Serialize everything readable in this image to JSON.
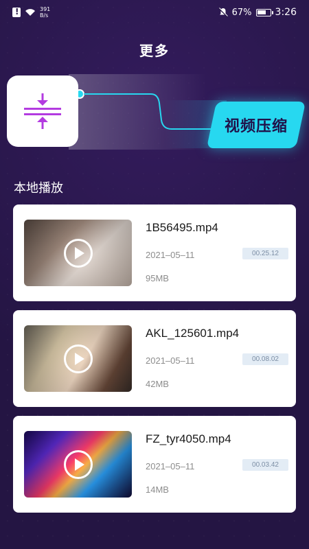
{
  "status_bar": {
    "speed_value": "391",
    "speed_unit": "B/s",
    "battery": "67%",
    "time": "3:26",
    "icons": [
      "alert-icon",
      "wifi-icon",
      "mute-bell-icon",
      "battery-icon"
    ]
  },
  "header": {
    "title": "更多"
  },
  "banner": {
    "button_label": "视频压缩",
    "icon": "compress-icon",
    "colors": {
      "accent": "#27d8f0",
      "icon_purple": "#b33be0"
    }
  },
  "section": {
    "title": "本地播放"
  },
  "videos": [
    {
      "name": "1B56495.mp4",
      "date": "2021–05–11",
      "duration": "00.25.12",
      "size": "95MB"
    },
    {
      "name": "AKL_125601.mp4",
      "date": "2021–05–11",
      "duration": "00.08.02",
      "size": "42MB"
    },
    {
      "name": "FZ_tyr4050.mp4",
      "date": "2021–05–11",
      "duration": "00.03.42",
      "size": "14MB"
    }
  ],
  "colors": {
    "background": "#241543",
    "card": "#ffffff",
    "duration_badge": "#e3ecf5"
  }
}
